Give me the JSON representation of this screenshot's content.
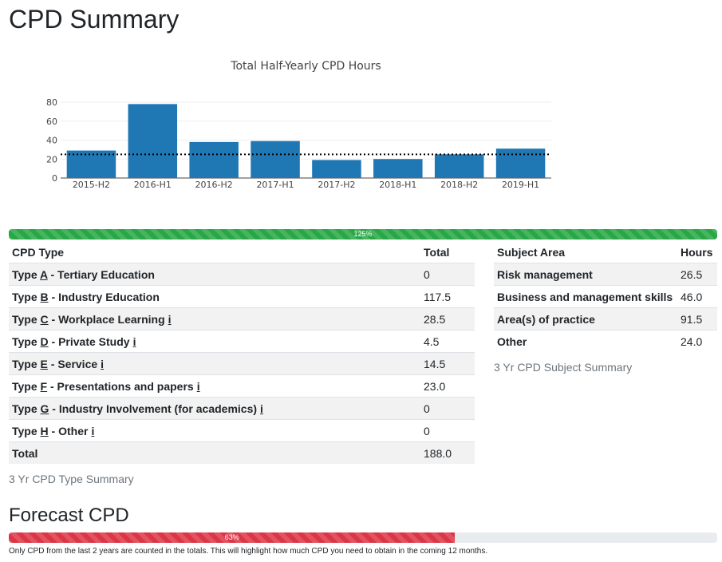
{
  "page_title": "CPD Summary",
  "chart_data": {
    "type": "bar",
    "title": "Total Half-Yearly CPD Hours",
    "categories": [
      "2015-H2",
      "2016-H1",
      "2016-H2",
      "2017-H1",
      "2017-H2",
      "2018-H1",
      "2018-H2",
      "2019-H1"
    ],
    "values": [
      29,
      78,
      38,
      39,
      19,
      20,
      25,
      31
    ],
    "ylim": [
      0,
      80
    ],
    "yticks": [
      0,
      20,
      40,
      60,
      80
    ],
    "reference_line": 25,
    "bar_color": "#1f77b4",
    "grid": true,
    "xlabel": "",
    "ylabel": ""
  },
  "progress_total": {
    "label": "125%",
    "percent": 100,
    "color": "#28a745"
  },
  "type_table": {
    "headers": [
      "CPD Type",
      "Total"
    ],
    "rows": [
      {
        "prefix": "Type ",
        "letter": "A",
        "name": " - Tertiary Education",
        "info": "",
        "total": "0"
      },
      {
        "prefix": "Type ",
        "letter": "B",
        "name": " - Industry Education",
        "info": "",
        "total": "117.5"
      },
      {
        "prefix": "Type ",
        "letter": "C",
        "name": " - Workplace Learning",
        "info": "i",
        "total": "28.5"
      },
      {
        "prefix": "Type ",
        "letter": "D",
        "name": " - Private Study",
        "info": "i",
        "total": "4.5"
      },
      {
        "prefix": "Type ",
        "letter": "E",
        "name": " - Service",
        "info": "i",
        "total": "14.5"
      },
      {
        "prefix": "Type ",
        "letter": "F",
        "name": " - Presentations and papers",
        "info": "i",
        "total": "23.0"
      },
      {
        "prefix": "Type ",
        "letter": "G",
        "name": " - Industry Involvement (for academics)",
        "info": "i",
        "total": "0"
      },
      {
        "prefix": "Type ",
        "letter": "H",
        "name": " - Other",
        "info": "i",
        "total": "0"
      }
    ],
    "total_label": "Total",
    "total_value": "188.0",
    "caption": "3 Yr CPD Type Summary"
  },
  "subject_table": {
    "headers": [
      "Subject Area",
      "Hours"
    ],
    "rows": [
      {
        "name": "Risk management",
        "hours": "26.5"
      },
      {
        "name": "Business and management skills",
        "hours": "46.0"
      },
      {
        "name": "Area(s) of practice",
        "hours": "91.5"
      },
      {
        "name": "Other",
        "hours": "24.0"
      }
    ],
    "caption": "3 Yr CPD Subject Summary"
  },
  "forecast": {
    "title": "Forecast CPD",
    "progress_label": "63%",
    "percent": 63,
    "color": "#dc3545",
    "note": "Only CPD from the last 2 years are counted in the totals. This will highlight how much CPD you need to obtain in the coming 12 months."
  }
}
